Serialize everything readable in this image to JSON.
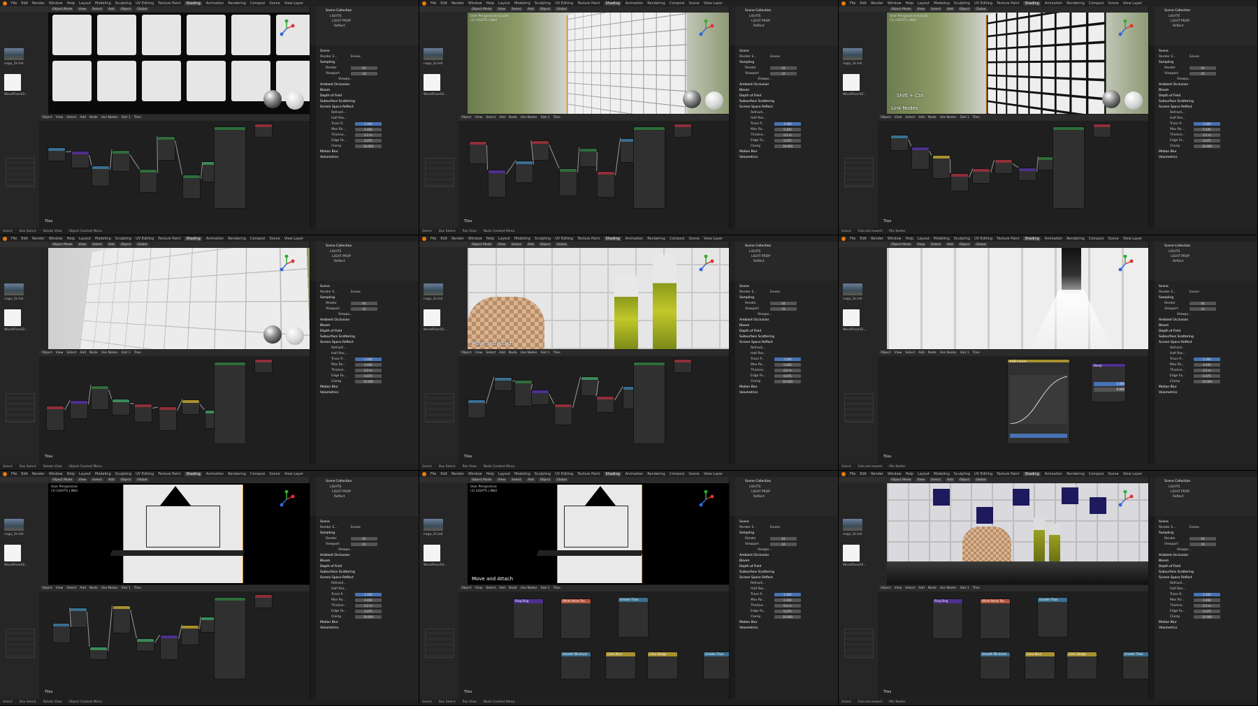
{
  "app": {
    "menu": [
      "File",
      "Edit",
      "Render",
      "Window",
      "Help"
    ],
    "workspaces": [
      "Layout",
      "Modeling",
      "Sculpting",
      "UV Editing",
      "Texture Paint",
      "Shading",
      "Animation",
      "Rendering",
      "Composi"
    ],
    "active_workspace": "Shading",
    "scene": "Scene",
    "view_layer": "View Layer"
  },
  "viewport_header": {
    "mode": "Object Mode",
    "menus": [
      "View",
      "Select",
      "Add",
      "Object"
    ],
    "transform": "Global",
    "options": "Options"
  },
  "node_header": {
    "type": "Object",
    "menus": [
      "View",
      "Select",
      "Add",
      "Node"
    ],
    "use_nodes": "Use Nodes",
    "slot": "Slot 1",
    "material": "Tiles"
  },
  "file_browser": {
    "hdri_file": "noga_1k.hdr",
    "texture_file": "WoodFloor02..."
  },
  "outliner": {
    "title": "Scene Collection",
    "items": [
      "LIGHTS",
      "LIGHT PROP",
      "Reflect"
    ]
  },
  "properties": {
    "scene_label": "Scene",
    "render_engine_label": "Render E...",
    "render_engine": "Eevee",
    "sampling": "Sampling",
    "render_label": "Render",
    "render_value": "64",
    "viewport_label": "Viewport",
    "viewport_value": "16",
    "viewport_denoise": "Viewpo...",
    "panels": [
      "Ambient Occlusion",
      "Bloom",
      "Depth of Field",
      "Subsurface Scattering",
      "Screen Space Reflect"
    ],
    "ssr_fields": [
      {
        "label": "Refracti..."
      },
      {
        "label": "Half Res..."
      },
      {
        "label": "Trace P...",
        "value": "1.000"
      },
      {
        "label": "Max Ro...",
        "value": "0.400"
      },
      {
        "label": "Thickne...",
        "value": "0.2 m"
      },
      {
        "label": "Edge Fa...",
        "value": "0.075"
      },
      {
        "label": "Clamp",
        "value": "10.000"
      }
    ],
    "panels_after": [
      "Motion Blur",
      "Volumetrics"
    ]
  },
  "status_bars": [
    [
      "Select",
      "Box Select",
      "Rotate View",
      "Object Context Menu"
    ],
    [
      "Select",
      "Box Select",
      "Pan View",
      "Node Context Menu"
    ],
    [
      "Select",
      "Extrude Inward",
      "Mix Nodes"
    ]
  ],
  "material_label": "Tiles",
  "cells": [
    {
      "perspective": "",
      "overlay": ""
    },
    {
      "perspective": "User Perspective (Local)\n(1) LIGHTS | Wall",
      "overlay": ""
    },
    {
      "perspective": "User Perspective (Local)\n(1) LIGHTS | Wall",
      "overlay_key": "Shift + Ctrl",
      "overlay": "Link Nodes"
    },
    {
      "perspective": "",
      "overlay": ""
    },
    {
      "perspective": "",
      "overlay": "Move and Attach"
    },
    {
      "perspective": "",
      "overlay": "",
      "curves_node": {
        "title": "RGB Curves",
        "output": "Color",
        "coords": [
          "X 0.01234",
          "Y 0.01357"
        ],
        "fac_label": "Fac",
        "fac": "1.000",
        "color_input": "Color"
      },
      "bump_node": {
        "title": "Bump",
        "output": "Normal",
        "invert": "Invert",
        "strength_label": "Strength",
        "strength": "1.000",
        "distance_label": "Distance",
        "distance": "0.000",
        "height": "Height",
        "normal": "Normal"
      }
    },
    {
      "perspective": "User Perspective\n(1) LIGHTS | Wall",
      "overlay": ""
    },
    {
      "perspective": "User Perspective\n(1) LIGHTS | Wall",
      "overlay": "Move and Attach"
    },
    {
      "perspective": "Camera Perspective\n(1) LIGHTS | Wall",
      "overlay": ""
    }
  ],
  "nodes_cell8": [
    {
      "title": "Ring Ring",
      "color": "#4e2f8f"
    },
    {
      "title": "White Noise Tex...",
      "color": "#b3503a"
    },
    {
      "title": "Greater Than",
      "color": "#3a6f8f"
    },
    {
      "title": "Smooth Minimum",
      "color": "#3a6f8f"
    },
    {
      "title": "Color Burn",
      "color": "#a8912e"
    },
    {
      "title": "Color Dodge",
      "color": "#a8912e"
    },
    {
      "title": "Greater Than",
      "color": "#3a6f8f"
    }
  ],
  "colors": {
    "accent_orange": "#e87d0d",
    "field_blue": "#4772b3",
    "node_bg": "#1f1f1f",
    "panel_bg": "#232323"
  }
}
